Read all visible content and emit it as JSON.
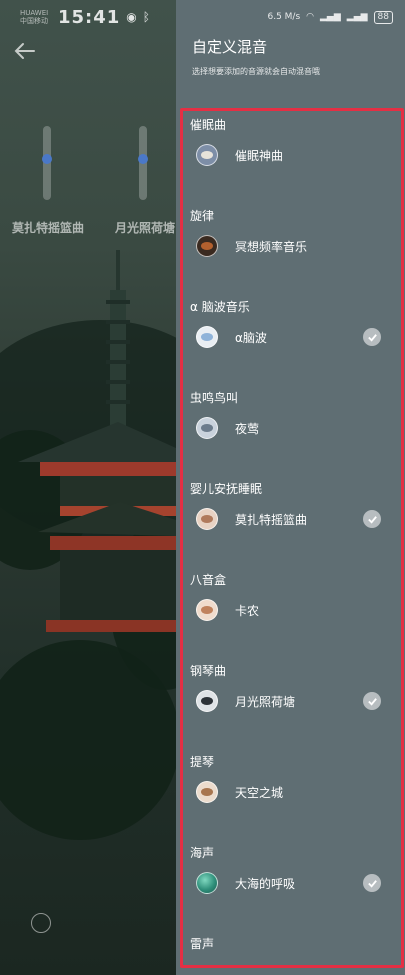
{
  "status_bar": {
    "carrier_line1": "HUAWEI",
    "carrier_line2": "中国移动",
    "time": "15:41",
    "network_speed": "6.5 M/s",
    "battery": "88"
  },
  "overlay": {
    "sliders": [
      {
        "label": "莫扎特摇篮曲",
        "level": 0.4
      },
      {
        "label": "月光照荷塘",
        "level": 0.4
      }
    ]
  },
  "panel": {
    "title": "自定义混音",
    "subtitle": "选择想要添加的音源就会自动混音哦"
  },
  "sections": [
    {
      "category": "催眠曲",
      "item": "催眠神曲",
      "checked": false,
      "avatar_color": "#7d8ea7"
    },
    {
      "category": "旋律",
      "item": "冥想频率音乐",
      "checked": false,
      "avatar_color": "#b3602e"
    },
    {
      "category": "α 脑波音乐",
      "item": "α脑波",
      "checked": true,
      "avatar_color": "#8fb3d9"
    },
    {
      "category": "虫鸣鸟叫",
      "item": "夜莺",
      "checked": false,
      "avatar_color": "#9aa6b5"
    },
    {
      "category": "婴儿安抚睡眠",
      "item": "莫扎特摇篮曲",
      "checked": true,
      "avatar_color": "#c9a184"
    },
    {
      "category": "八音盒",
      "item": "卡农",
      "checked": false,
      "avatar_color": "#d09a7c"
    },
    {
      "category": "钢琴曲",
      "item": "月光照荷塘",
      "checked": true,
      "avatar_color": "#5e6a72"
    },
    {
      "category": "提琴",
      "item": "天空之城",
      "checked": false,
      "avatar_color": "#c49b7e"
    },
    {
      "category": "海声",
      "item": "大海的呼吸",
      "checked": true,
      "avatar_color": "#2f8f7a"
    },
    {
      "category": "雷声",
      "item": "",
      "checked": false,
      "avatar_color": ""
    }
  ]
}
